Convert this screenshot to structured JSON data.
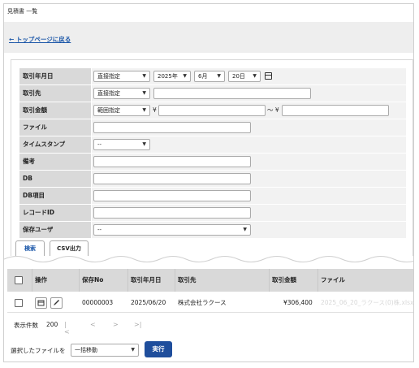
{
  "page": {
    "title": "見積書 一覧",
    "back_link": "トップページに戻る",
    "back_arrow": "←"
  },
  "form": {
    "rows": [
      {
        "label": "取引年月日",
        "mode": "直接指定",
        "year": "2025年",
        "month": "6月",
        "day": "20日"
      },
      {
        "label": "取引先",
        "mode": "直接指定",
        "value": ""
      },
      {
        "label": "取引金額",
        "mode": "範囲指定",
        "yen": "¥",
        "tilde": "〜 ¥",
        "from": "",
        "to": ""
      },
      {
        "label": "ファイル",
        "value": ""
      },
      {
        "label": "タイムスタンプ",
        "value": "--"
      },
      {
        "label": "備考",
        "value": ""
      },
      {
        "label": "DB",
        "value": ""
      },
      {
        "label": "DB項目",
        "value": ""
      },
      {
        "label": "レコードID",
        "value": ""
      },
      {
        "label": "保存ユーザ",
        "value": "--"
      }
    ]
  },
  "tabs": [
    {
      "label": "検索",
      "active": true
    },
    {
      "label": "CSV出力",
      "active": false
    }
  ],
  "table": {
    "columns": [
      "操作",
      "保存No",
      "取引年月日",
      "取引先",
      "取引金額",
      "ファイル"
    ],
    "rows": [
      {
        "save_no": "00000003",
        "date": "2025/06/20",
        "partner": "株式会社ラクース",
        "amount": "¥306,400",
        "file": "2025_06_20_ラクース(0)株.xlsx"
      }
    ]
  },
  "pager": {
    "label": "表示件数",
    "count": "200",
    "first": "|<",
    "prev": "<",
    "next": ">",
    "last": ">|"
  },
  "bulk": {
    "label": "選択したファイルを",
    "action": "一括移動",
    "run": "実行"
  },
  "icons": [
    "calendar-icon",
    "pencil-icon",
    "caret-down-icon",
    "arrow-left-icon"
  ],
  "colors": {
    "link": "#1a56a8",
    "primary": "#1f4e9c",
    "label_bg": "#d9d9d9"
  }
}
